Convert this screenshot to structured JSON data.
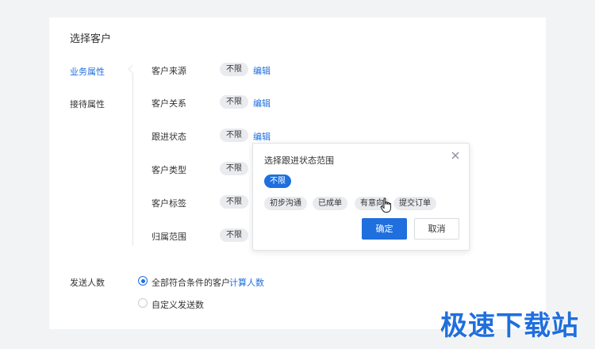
{
  "page": {
    "title": "选择客户"
  },
  "sidebar": {
    "items": [
      {
        "label": "业务属性",
        "active": true
      },
      {
        "label": "接待属性",
        "active": false
      }
    ]
  },
  "filters": [
    {
      "label": "客户来源",
      "value": "不限",
      "edit": "编辑"
    },
    {
      "label": "客户关系",
      "value": "不限",
      "edit": "编辑"
    },
    {
      "label": "跟进状态",
      "value": "不限",
      "edit": "编辑"
    },
    {
      "label": "客户类型",
      "value": "不限"
    },
    {
      "label": "客户标签",
      "value": "不限"
    },
    {
      "label": "归属范围",
      "value": "不限"
    }
  ],
  "send": {
    "label": "发送人数",
    "options": [
      {
        "label": "全部符合条件的客户",
        "checked": true
      },
      {
        "label": "自定义发送数",
        "checked": false
      }
    ],
    "calc_link": "计算人数"
  },
  "popup": {
    "title": "选择跟进状态范围",
    "options": [
      {
        "label": "不限",
        "selected": true
      },
      {
        "label": "初步沟通",
        "selected": false
      },
      {
        "label": "已成单",
        "selected": false
      },
      {
        "label": "有意向",
        "selected": false
      },
      {
        "label": "提交订单",
        "selected": false
      }
    ],
    "confirm": "确定",
    "cancel": "取消"
  },
  "watermark": "极速下载站",
  "colors": {
    "accent": "#1f6fde",
    "chip_bg": "#e9ebef",
    "background": "#f2f3f5"
  }
}
